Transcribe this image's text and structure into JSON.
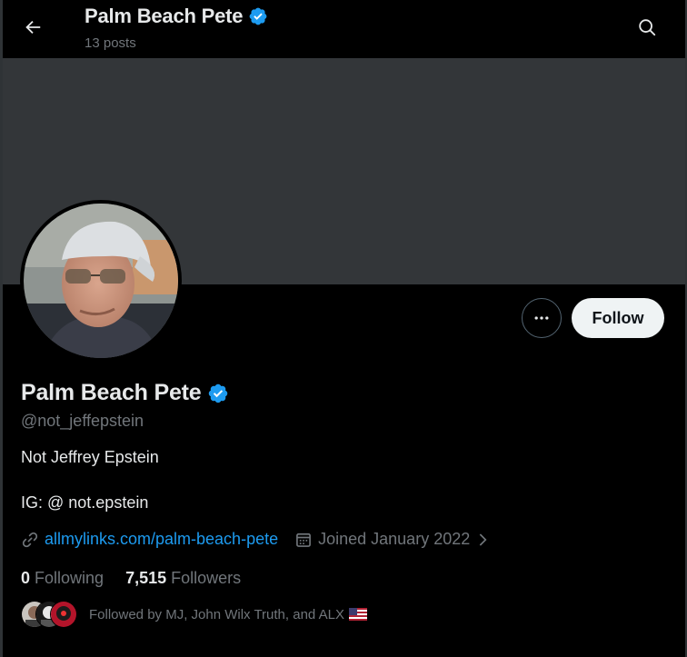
{
  "header": {
    "back_icon": "arrow-left-icon",
    "name": "Palm Beach Pete",
    "posts_count": "13 posts",
    "search_icon": "search-icon",
    "verified_icon": "verified-badge-icon"
  },
  "profile": {
    "display_name": "Palm Beach Pete",
    "handle": "@not_jeffepstein",
    "bio_line1": "Not Jeffrey Epstein",
    "bio_line2": "IG: @ not.epstein",
    "link": "allmylinks.com/palm-beach-pete",
    "joined": "Joined January 2022",
    "following_count": "0",
    "following_label": "Following",
    "followers_count": "7,515",
    "followers_label": "Followers",
    "followed_by": "Followed by MJ, John Wilx Truth, and ALX"
  },
  "actions": {
    "more_icon": "more-horizontal-icon",
    "follow_label": "Follow"
  },
  "colors": {
    "background": "#000000",
    "banner": "#333639",
    "accent": "#1d9bf0",
    "text_primary": "#e7e9ea",
    "text_secondary": "#71767b",
    "follow_button_bg": "#eff3f4"
  }
}
